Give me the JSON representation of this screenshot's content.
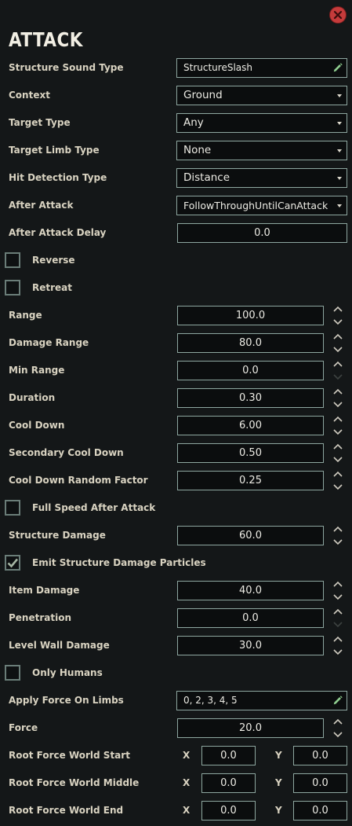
{
  "title": "ATTACK",
  "colors": {
    "accent_border": "#8ea7a0",
    "close_button": "#c53b3b",
    "pencil_icon": "#8fce8f"
  },
  "rows": {
    "structure_sound_type": {
      "label": "Structure Sound Type",
      "value": "StructureSlash"
    },
    "context": {
      "label": "Context",
      "value": "Ground"
    },
    "target_type": {
      "label": "Target Type",
      "value": "Any"
    },
    "target_limb_type": {
      "label": "Target Limb Type",
      "value": "None"
    },
    "hit_detection_type": {
      "label": "Hit Detection Type",
      "value": "Distance"
    },
    "after_attack": {
      "label": "After Attack",
      "value": "FollowThroughUntilCanAttack"
    },
    "after_attack_delay": {
      "label": "After Attack Delay",
      "value": "0.0"
    },
    "reverse": {
      "label": "Reverse",
      "checked": false
    },
    "retreat": {
      "label": "Retreat",
      "checked": false
    },
    "range": {
      "label": "Range",
      "value": "100.0"
    },
    "damage_range": {
      "label": "Damage Range",
      "value": "80.0"
    },
    "min_range": {
      "label": "Min Range",
      "value": "0.0"
    },
    "duration": {
      "label": "Duration",
      "value": "0.30"
    },
    "cool_down": {
      "label": "Cool Down",
      "value": "6.00"
    },
    "secondary_cool_down": {
      "label": "Secondary Cool Down",
      "value": "0.50"
    },
    "cool_down_random_factor": {
      "label": "Cool Down Random Factor",
      "value": "0.25"
    },
    "full_speed_after_attack": {
      "label": "Full Speed After Attack",
      "checked": false
    },
    "structure_damage": {
      "label": "Structure Damage",
      "value": "60.0"
    },
    "emit_structure_damage_particles": {
      "label": "Emit Structure Damage Particles",
      "checked": true
    },
    "item_damage": {
      "label": "Item Damage",
      "value": "40.0"
    },
    "penetration": {
      "label": "Penetration",
      "value": "0.0"
    },
    "level_wall_damage": {
      "label": "Level Wall Damage",
      "value": "30.0"
    },
    "only_humans": {
      "label": "Only Humans",
      "checked": false
    },
    "apply_force_on_limbs": {
      "label": "Apply Force On Limbs",
      "value": "0, 2, 3, 4, 5"
    },
    "force": {
      "label": "Force",
      "value": "20.0"
    },
    "root_force_world_start": {
      "label": "Root Force World Start",
      "x_label": "X",
      "x": "0.0",
      "y_label": "Y",
      "y": "0.0"
    },
    "root_force_world_middle": {
      "label": "Root Force World Middle",
      "x_label": "X",
      "x": "0.0",
      "y_label": "Y",
      "y": "0.0"
    },
    "root_force_world_end": {
      "label": "Root Force World End",
      "x_label": "X",
      "x": "0.0",
      "y_label": "Y",
      "y": "0.0"
    }
  }
}
